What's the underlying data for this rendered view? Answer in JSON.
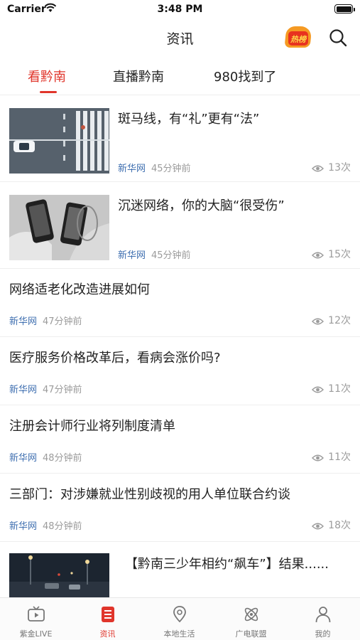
{
  "status_bar": {
    "carrier": "Carrier",
    "time": "3:48 PM"
  },
  "nav": {
    "title": "资讯",
    "hot_label": "热榜"
  },
  "tabs": [
    {
      "label": "看黔南",
      "active": true
    },
    {
      "label": "直播黔南",
      "active": false
    },
    {
      "label": "980找到了",
      "active": false
    }
  ],
  "articles": [
    {
      "title": "斑马线，有“礼”更有“法”",
      "source": "新华网",
      "time": "45分钟前",
      "views": "13次",
      "has_image": true,
      "image": "crosswalk-photo"
    },
    {
      "title": "沉迷网络，你的大脑“很受伤”",
      "source": "新华网",
      "time": "45分钟前",
      "views": "15次",
      "has_image": true,
      "image": "smartphones-photo"
    },
    {
      "title": "网络适老化改造进展如何",
      "source": "新华网",
      "time": "47分钟前",
      "views": "12次",
      "has_image": false
    },
    {
      "title": "医疗服务价格改革后，看病会涨价吗?",
      "source": "新华网",
      "time": "47分钟前",
      "views": "11次",
      "has_image": false
    },
    {
      "title": "注册会计师行业将列制度清单",
      "source": "新华网",
      "time": "48分钟前",
      "views": "11次",
      "has_image": false
    },
    {
      "title": "三部门：对涉嫌就业性别歧视的用人单位联合约谈",
      "source": "新华网",
      "time": "48分钟前",
      "views": "18次",
      "has_image": false
    },
    {
      "title": "【黔南三少年相约“飙车”】结果......",
      "has_image": true,
      "image": "night-street-photo"
    }
  ],
  "tabbar": [
    {
      "label": "紫金LIVE",
      "icon": "tv-icon",
      "active": false
    },
    {
      "label": "资讯",
      "icon": "news-icon",
      "active": true
    },
    {
      "label": "本地生活",
      "icon": "location-icon",
      "active": false
    },
    {
      "label": "广电联盟",
      "icon": "atom-icon",
      "active": false
    },
    {
      "label": "我的",
      "icon": "person-icon",
      "active": false
    }
  ],
  "colors": {
    "accent": "#e0352b",
    "source": "#3f6fb0",
    "meta": "#9b9b9b"
  }
}
